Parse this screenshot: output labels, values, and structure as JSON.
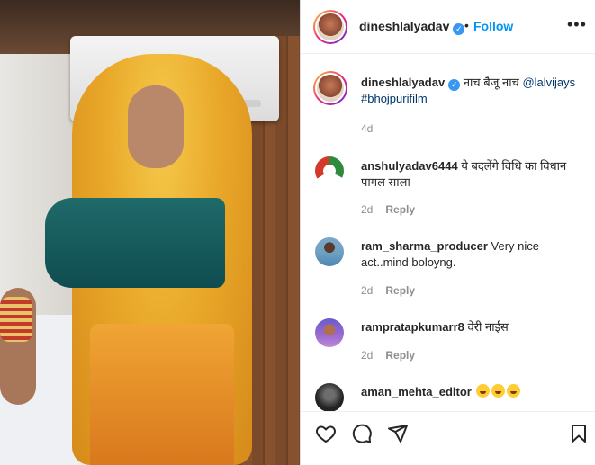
{
  "post": {
    "username": "dineshlalyadav",
    "verified_mark": "✓",
    "separator": "•",
    "follow_label": "Follow",
    "more_label": "•••"
  },
  "caption": {
    "username": "dineshlalyadav",
    "text": "नाच बैजू नाच",
    "mention": "@lalvijays",
    "hashtag": "#bhojpurifilm",
    "age": "4d"
  },
  "comments": [
    {
      "username": "anshulyadav6444",
      "text": "ये बदलेंगे विधि का विधान पागल साला",
      "age": "2d",
      "reply_label": "Reply",
      "avatar": "flag-avatar"
    },
    {
      "username": "ram_sharma_producer",
      "text": "Very nice act..mind boloyng.",
      "age": "2d",
      "reply_label": "Reply",
      "avatar": "man-avatar"
    },
    {
      "username": "rampratapkumarr8",
      "text": "वेरी नाईस",
      "age": "2d",
      "reply_label": "Reply",
      "avatar": "man-avatar"
    },
    {
      "username": "aman_mehta_editor",
      "text": "",
      "age": "",
      "reply_label": "",
      "avatar": "dark-avatar"
    }
  ],
  "actions": {
    "like_icon": "heart-icon",
    "comment_icon": "comment-icon",
    "share_icon": "paper-plane-icon",
    "save_icon": "bookmark-icon"
  },
  "colors": {
    "follow": "#0095f6",
    "verified": "#3897f0",
    "mention": "#00376b",
    "muted": "#8e8e8e"
  }
}
